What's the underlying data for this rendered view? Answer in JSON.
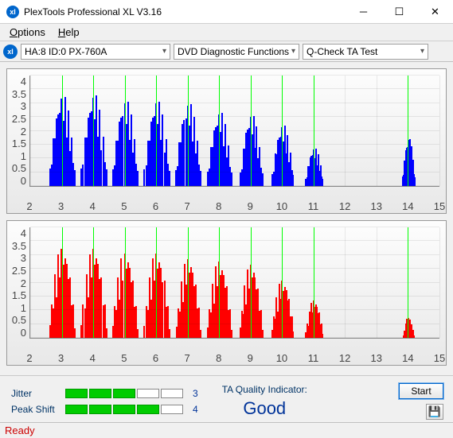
{
  "window": {
    "title": "PlexTools Professional XL V3.16",
    "icon_label": "xl"
  },
  "menu": {
    "options": "Options",
    "help": "Help"
  },
  "toolbar": {
    "device": "HA:8 ID:0   PX-760A",
    "category": "DVD Diagnostic Functions",
    "test": "Q-Check TA Test"
  },
  "chart_data": [
    {
      "type": "bar",
      "color": "#0000ff",
      "ylim": [
        0,
        4
      ],
      "yticks": [
        0,
        0.5,
        1,
        1.5,
        2,
        2.5,
        3,
        3.5,
        4
      ],
      "xlim": [
        2,
        15
      ],
      "xticks": [
        2,
        3,
        4,
        5,
        6,
        7,
        8,
        9,
        10,
        11,
        12,
        13,
        14,
        15
      ],
      "markers": [
        3,
        4,
        5,
        6,
        7,
        8,
        9,
        10,
        11,
        14
      ],
      "clusters": [
        {
          "center": 3,
          "peak": 3.1,
          "width": 0.9
        },
        {
          "center": 4,
          "peak": 3.15,
          "width": 0.9
        },
        {
          "center": 5,
          "peak": 2.95,
          "width": 0.9
        },
        {
          "center": 6,
          "peak": 2.95,
          "width": 0.9
        },
        {
          "center": 7,
          "peak": 2.85,
          "width": 0.9
        },
        {
          "center": 8,
          "peak": 2.55,
          "width": 0.85
        },
        {
          "center": 9,
          "peak": 2.45,
          "width": 0.8
        },
        {
          "center": 10,
          "peak": 2.1,
          "width": 0.75
        },
        {
          "center": 11,
          "peak": 1.3,
          "width": 0.6
        },
        {
          "center": 14,
          "peak": 1.65,
          "width": 0.45
        }
      ]
    },
    {
      "type": "bar",
      "color": "#ff0000",
      "ylim": [
        0,
        4
      ],
      "yticks": [
        0,
        0.5,
        1,
        1.5,
        2,
        2.5,
        3,
        3.5,
        4
      ],
      "xlim": [
        2,
        15
      ],
      "xticks": [
        2,
        3,
        4,
        5,
        6,
        7,
        8,
        9,
        10,
        11,
        12,
        13,
        14,
        15
      ],
      "markers": [
        3,
        4,
        5,
        6,
        7,
        8,
        9,
        10,
        11,
        14
      ],
      "clusters": [
        {
          "center": 3,
          "peak": 3.1,
          "width": 0.9
        },
        {
          "center": 4,
          "peak": 3.1,
          "width": 0.9
        },
        {
          "center": 5,
          "peak": 2.95,
          "width": 0.9
        },
        {
          "center": 6,
          "peak": 2.95,
          "width": 0.9
        },
        {
          "center": 7,
          "peak": 2.75,
          "width": 0.85
        },
        {
          "center": 8,
          "peak": 2.65,
          "width": 0.85
        },
        {
          "center": 9,
          "peak": 2.55,
          "width": 0.8
        },
        {
          "center": 10,
          "peak": 2.0,
          "width": 0.75
        },
        {
          "center": 11,
          "peak": 1.3,
          "width": 0.6
        },
        {
          "center": 14,
          "peak": 0.7,
          "width": 0.35
        }
      ]
    }
  ],
  "metrics": {
    "jitter": {
      "label": "Jitter",
      "filled": 3,
      "total": 5,
      "value": "3"
    },
    "peak_shift": {
      "label": "Peak Shift",
      "filled": 4,
      "total": 5,
      "value": "4"
    }
  },
  "quality": {
    "label": "TA Quality Indicator:",
    "value": "Good"
  },
  "buttons": {
    "start": "Start"
  },
  "status": {
    "text": "Ready"
  }
}
